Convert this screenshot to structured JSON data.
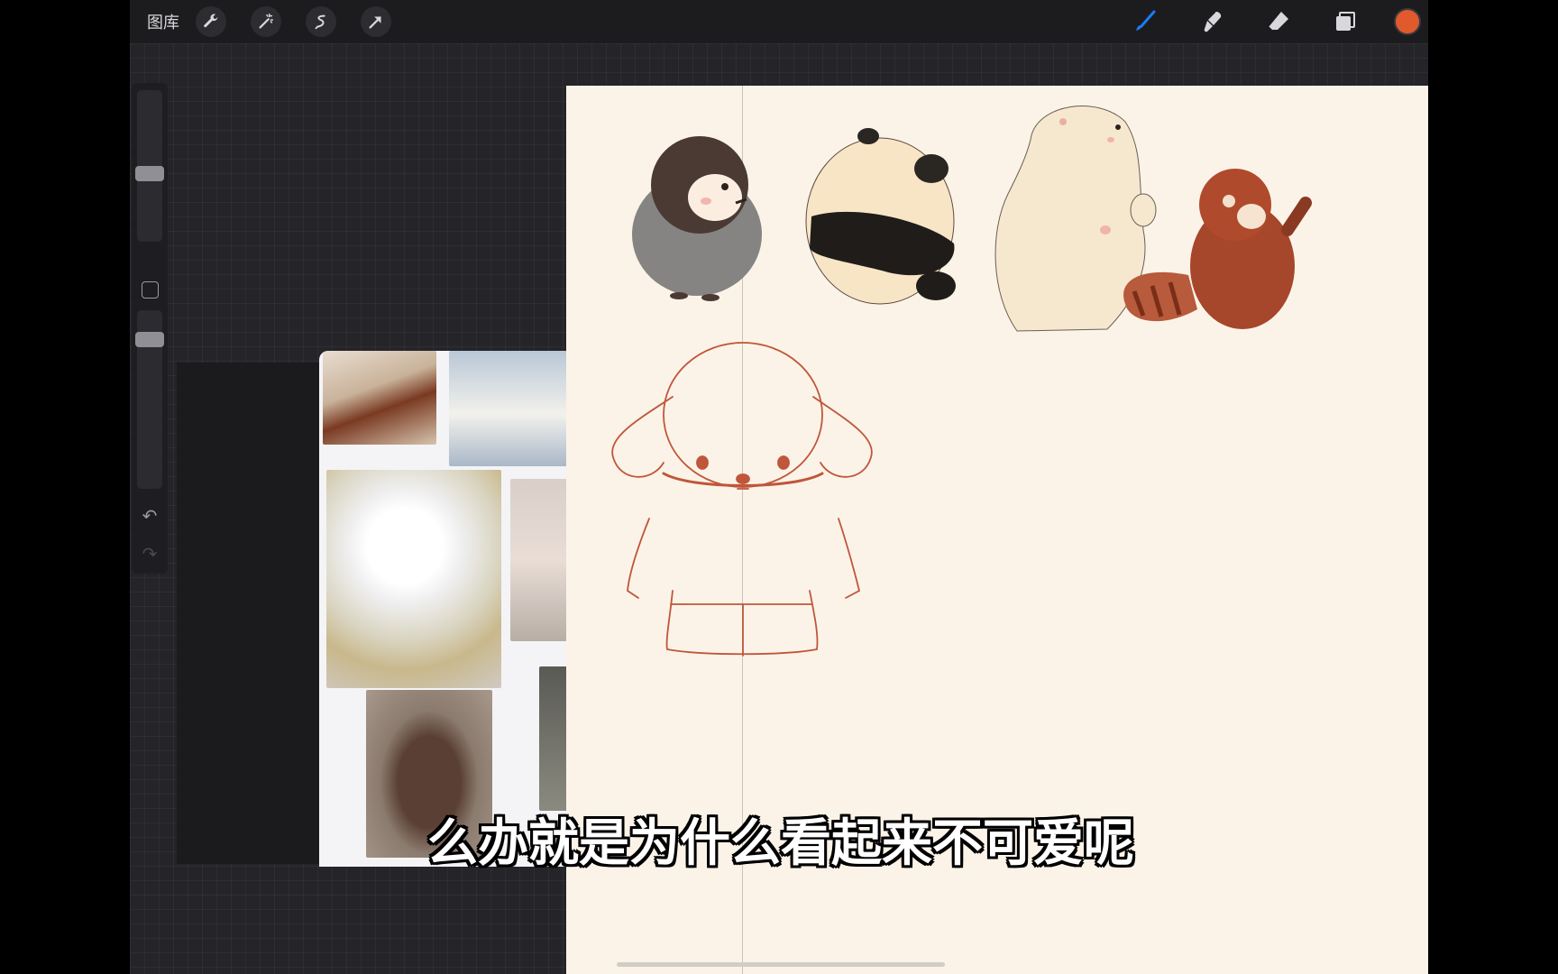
{
  "topbar": {
    "gallery_label": "图库",
    "left_tools": [
      "wrench-icon",
      "magic-wand-icon",
      "selection-icon",
      "transform-arrow-icon"
    ],
    "right_tools": [
      "brush-icon",
      "smudge-icon",
      "eraser-icon",
      "layers-icon"
    ],
    "active_color": "#e05a2d",
    "brush_accent": "#1a7cf5"
  },
  "sidebar": {
    "brush_size_level": 0.55,
    "opacity_level": 0.95
  },
  "subtitle": "么办就是为什么看起来不可爱呢"
}
